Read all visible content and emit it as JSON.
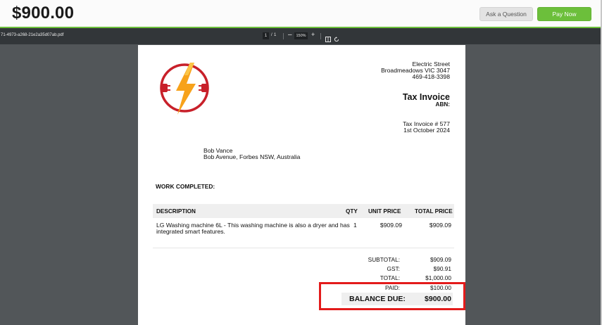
{
  "header": {
    "amount": "$900.00",
    "ask_button": "Ask a Question",
    "pay_button": "Pay Now",
    "accent_color": "#6cbf3b"
  },
  "viewer": {
    "file_name": "71-4973-a268-21e2a35d07ab.pdf",
    "current_page": "1",
    "page_separator": "/",
    "total_pages": "1",
    "zoom_out_label": "–",
    "zoom": "150%",
    "zoom_in_label": "+",
    "fit_icon": "fit-page-icon",
    "rotate_icon": "rotate-icon"
  },
  "invoice": {
    "logo_icon": "lightning-plug-logo",
    "address_line1": "Electric Street",
    "address_line2": "Broadmeadows VIC 3047",
    "phone": "469-418-3398",
    "title": "Tax Invoice",
    "abn_label": "ABN:",
    "invoice_number": "Tax Invoice # 577",
    "date": "1st October 2024",
    "customer_name": "Bob Vance",
    "customer_address": "Bob Avenue, Forbes NSW, Australia",
    "work_heading": "WORK COMPLETED:",
    "table": {
      "columns": [
        "DESCRIPTION",
        "QTY",
        "UNIT PRICE",
        "TOTAL PRICE"
      ],
      "rows": [
        {
          "description_line1": "LG Washing machine 6L - This washing machine is also a dryer and has",
          "description_line2": "integrated smart features.",
          "qty": "1",
          "unit_price": "$909.09",
          "total_price": "$909.09"
        }
      ]
    },
    "totals": {
      "subtotal_label": "SUBTOTAL:",
      "subtotal": "$909.09",
      "gst_label": "GST:",
      "gst": "$90.91",
      "total_label": "TOTAL:",
      "total": "$1,000.00",
      "paid_label": "PAID:",
      "paid": "$100.00",
      "balance_label": "BALANCE DUE:",
      "balance": "$900.00"
    },
    "highlight_color": "#e31b1b"
  }
}
